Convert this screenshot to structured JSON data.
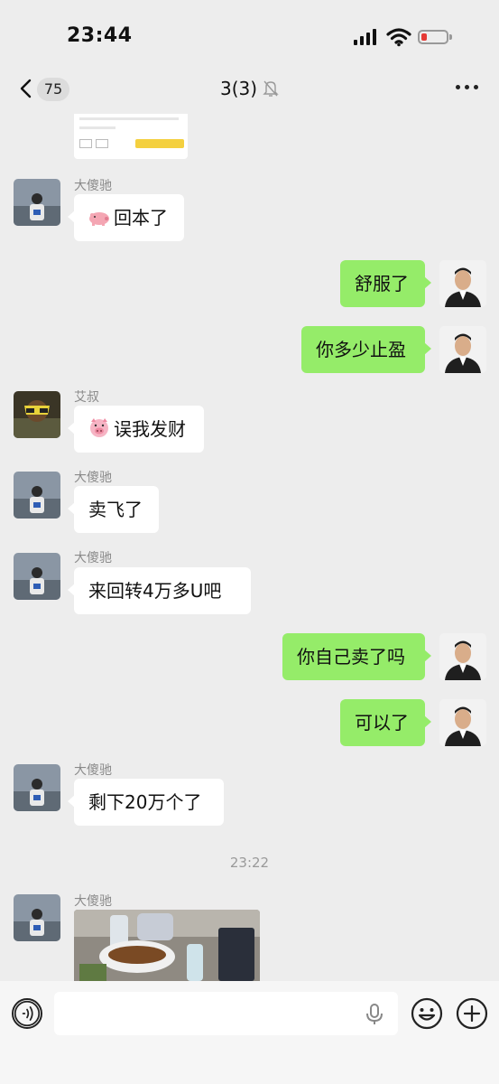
{
  "status_bar": {
    "time": "23:44"
  },
  "nav": {
    "back_count": "75",
    "title": "3(3)"
  },
  "messages": [
    {
      "sender": "大傻驰",
      "emoji": "pig-nose",
      "text": "回本了"
    },
    {
      "sender": "me",
      "text": "舒服了"
    },
    {
      "sender": "me",
      "text": "你多少止盈"
    },
    {
      "sender": "艾叔",
      "emoji": "pig-face",
      "text": "误我发财"
    },
    {
      "sender": "大傻驰",
      "text": "卖飞了"
    },
    {
      "sender": "大傻驰",
      "text": "来回转4万多U吧"
    },
    {
      "sender": "me",
      "text": "你自己卖了吗"
    },
    {
      "sender": "me",
      "text": "可以了"
    },
    {
      "sender": "大傻驰",
      "text": "剩下20万个了"
    },
    {
      "sender": "大傻驰",
      "type": "image"
    }
  ],
  "timestamp": "23:22",
  "input_bar": {
    "voice_icon": "voice-icon",
    "mic_icon": "mic-icon",
    "emoji_icon": "emoji-icon",
    "plus_icon": "plus-icon"
  },
  "colors": {
    "background": "#ededed",
    "my_bubble": "#95ec69",
    "their_bubble": "#ffffff"
  }
}
